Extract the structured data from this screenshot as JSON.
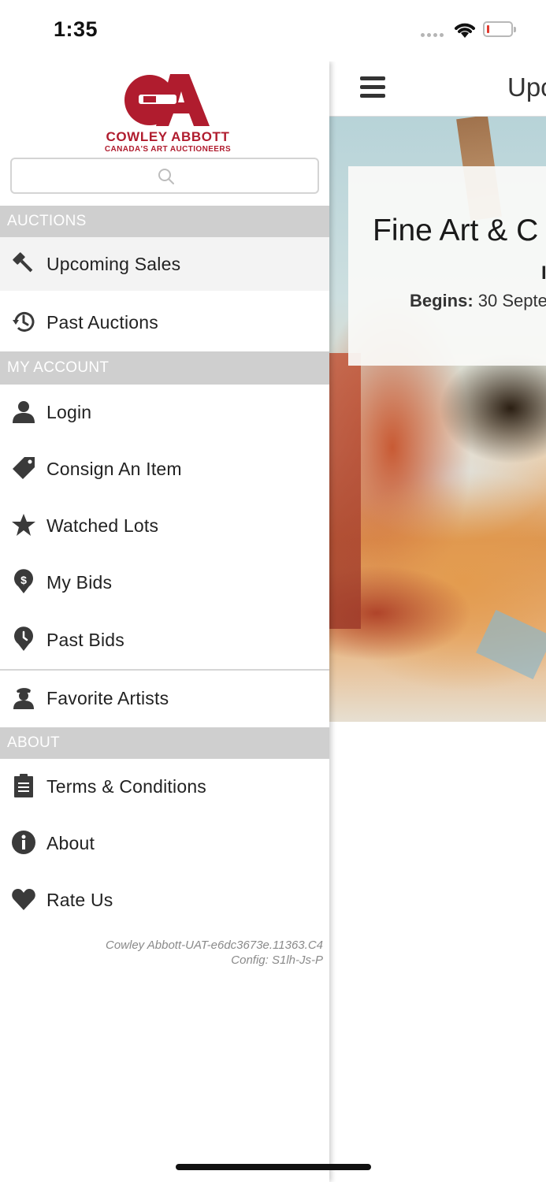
{
  "status_bar": {
    "time": "1:35"
  },
  "main": {
    "title": "Upc",
    "hero": {
      "title": "Fine Art & C",
      "subtitle": "I",
      "begins_label": "Begins:",
      "begins_value": " 30 Septe"
    }
  },
  "drawer": {
    "logo": {
      "name": "COWLEY ABBOTT",
      "tagline": "CANADA'S ART AUCTIONEERS",
      "color": "#b01c2e"
    },
    "search": {
      "placeholder": "",
      "value": ""
    },
    "sections": {
      "auctions": "AUCTIONS",
      "my_account": "MY ACCOUNT",
      "about": "ABOUT"
    },
    "items": {
      "upcoming_sales": {
        "label": "Upcoming Sales",
        "icon": "gavel-icon"
      },
      "past_auctions": {
        "label": "Past Auctions",
        "icon": "history-icon"
      },
      "login": {
        "label": "Login",
        "icon": "user-icon"
      },
      "consign": {
        "label": "Consign An Item",
        "icon": "tag-icon"
      },
      "watched_lots": {
        "label": "Watched Lots",
        "icon": "star-icon"
      },
      "my_bids": {
        "label": "My Bids",
        "icon": "dollar-pin-icon"
      },
      "past_bids": {
        "label": "Past Bids",
        "icon": "clock-pin-icon"
      },
      "favorite_artists": {
        "label": "Favorite Artists",
        "icon": "artist-icon"
      },
      "terms": {
        "label": "Terms & Conditions",
        "icon": "clipboard-icon"
      },
      "about": {
        "label": "About",
        "icon": "info-icon"
      },
      "rate_us": {
        "label": "Rate Us",
        "icon": "heart-icon"
      }
    },
    "version": {
      "line1": "Cowley Abbott-UAT-e6dc3673e.11363.C4",
      "line2": "Config: S1lh-Js-P"
    }
  }
}
